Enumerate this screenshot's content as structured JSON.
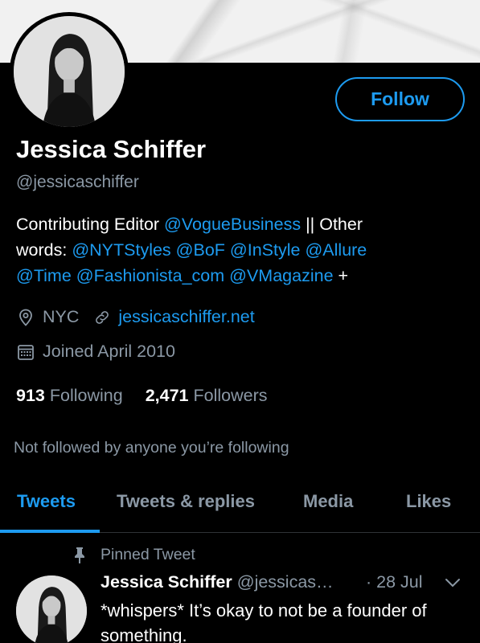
{
  "profile": {
    "name": "Jessica Schiffer",
    "handle": "@jessicaschiffer",
    "follow_label": "Follow",
    "bio": {
      "line1_text": "Contributing Editor ",
      "line1_mention": "@VogueBusiness",
      "line1_tail": " || Other",
      "line2_text": "words: ",
      "line2_mentions": [
        "@NYTStyles",
        "@BoF",
        "@InStyle",
        "@Allure"
      ],
      "line3_mentions": [
        "@Time",
        "@Fashionista_com",
        "@VMagazine"
      ],
      "line3_tail": " +"
    },
    "location": "NYC",
    "website": "jessicaschiffer.net",
    "joined": "Joined April 2010",
    "following_count": "913",
    "following_label": "Following",
    "followers_count": "2,471",
    "followers_label": "Followers",
    "not_followed": "Not followed by anyone you’re following"
  },
  "tabs": [
    {
      "label": "Tweets",
      "active": true
    },
    {
      "label": "Tweets & replies",
      "active": false
    },
    {
      "label": "Media",
      "active": false
    },
    {
      "label": "Likes",
      "active": false
    }
  ],
  "pinned_tweet": {
    "label": "Pinned Tweet",
    "author_name": "Jessica Schiffer",
    "author_handle": "@jessicas…",
    "date": "· 28 Jul",
    "text": "*whispers* It’s okay to not be a founder of something."
  },
  "icons": {
    "location": "location-pin-icon",
    "link": "link-icon",
    "calendar": "calendar-icon",
    "pin": "pin-icon",
    "chevron": "chevron-down-icon"
  },
  "colors": {
    "accent": "#1d9bf0",
    "secondary_text": "#8b98a5",
    "background": "#000000"
  }
}
